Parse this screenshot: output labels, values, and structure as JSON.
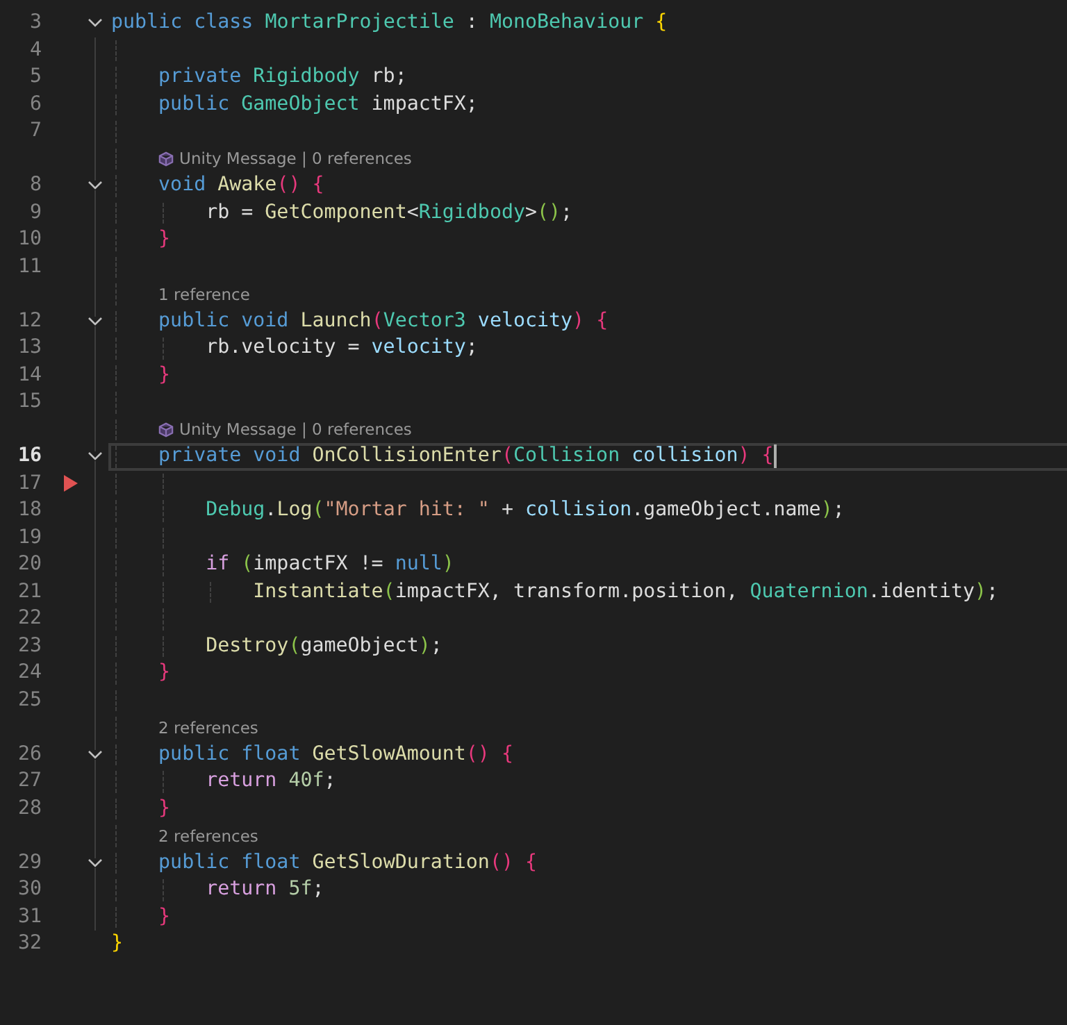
{
  "editor": {
    "rows": [
      {
        "kind": "code",
        "number": "3",
        "foldable": true,
        "selected": false,
        "marker": false,
        "tokens": [
          {
            "text": "public class ",
            "kind": "k"
          },
          {
            "text": "MortarProjectile",
            "kind": "t"
          },
          {
            "text": " : ",
            "kind": "p"
          },
          {
            "text": "MonoBehaviour ",
            "kind": "t"
          },
          {
            "text": "{",
            "kind": "b1"
          }
        ],
        "children": [
          {
            "kind": "code",
            "number": "4",
            "foldable": false,
            "selected": false,
            "marker": false
          },
          {
            "kind": "code",
            "number": "5",
            "foldable": false,
            "selected": false,
            "marker": false,
            "tokens": [
              {
                "text": "private ",
                "kind": "k"
              },
              {
                "text": "Rigidbody",
                "kind": "t"
              },
              {
                "text": " rb;",
                "kind": "p"
              }
            ]
          },
          {
            "kind": "code",
            "number": "6",
            "foldable": false,
            "selected": false,
            "marker": false,
            "tokens": [
              {
                "text": "public ",
                "kind": "k"
              },
              {
                "text": "GameObject",
                "kind": "t"
              },
              {
                "text": " impactFX;",
                "kind": "p"
              }
            ]
          },
          {
            "kind": "code",
            "number": "7",
            "foldable": false,
            "selected": false,
            "marker": false
          },
          {
            "kind": "unity_lens",
            "text": "Unity Message | 0 references"
          },
          {
            "kind": "code",
            "number": "8",
            "foldable": true,
            "selected": false,
            "marker": false,
            "tokens": [
              {
                "text": "void ",
                "kind": "k"
              },
              {
                "text": "Awake",
                "kind": "f"
              },
              {
                "text": "() {",
                "kind": "b2"
              }
            ],
            "children": [
              {
                "kind": "code",
                "number": "9",
                "foldable": false,
                "selected": false,
                "marker": false,
                "tokens": [
                  {
                    "text": "rb = ",
                    "kind": "p"
                  },
                  {
                    "text": "GetComponent",
                    "kind": "f"
                  },
                  {
                    "text": "<",
                    "kind": "p"
                  },
                  {
                    "text": "Rigidbody",
                    "kind": "t"
                  },
                  {
                    "text": ">",
                    "kind": "p"
                  },
                  {
                    "text": "()",
                    "kind": "b3"
                  },
                  {
                    "text": ";",
                    "kind": "p"
                  }
                ]
              }
            ]
          },
          {
            "kind": "code",
            "number": "10",
            "foldable": false,
            "selected": false,
            "marker": false,
            "tokens": [
              {
                "text": "}",
                "kind": "b2"
              }
            ]
          },
          {
            "kind": "code",
            "number": "11",
            "foldable": false,
            "selected": false,
            "marker": false
          },
          {
            "kind": "lens",
            "text": "1 reference"
          },
          {
            "kind": "code",
            "number": "12",
            "foldable": true,
            "selected": false,
            "marker": false,
            "tokens": [
              {
                "text": "public void ",
                "kind": "k"
              },
              {
                "text": "Launch",
                "kind": "f"
              },
              {
                "text": "(",
                "kind": "b2"
              },
              {
                "text": "Vector3",
                "kind": "t"
              },
              {
                "text": " velocity",
                "kind": "v"
              },
              {
                "text": ") {",
                "kind": "b2"
              }
            ],
            "children": [
              {
                "kind": "code",
                "number": "13",
                "foldable": false,
                "selected": false,
                "marker": false,
                "tokens": [
                  {
                    "text": "rb.velocity = ",
                    "kind": "p"
                  },
                  {
                    "text": "velocity",
                    "kind": "v"
                  },
                  {
                    "text": ";",
                    "kind": "p"
                  }
                ]
              }
            ]
          },
          {
            "kind": "code",
            "number": "14",
            "foldable": false,
            "selected": false,
            "marker": false,
            "tokens": [
              {
                "text": "}",
                "kind": "b2"
              }
            ]
          },
          {
            "kind": "code",
            "number": "15",
            "foldable": false,
            "selected": false,
            "marker": false
          },
          {
            "kind": "unity_lens",
            "text": "Unity Message | 0 references"
          },
          {
            "kind": "code",
            "number": "16",
            "foldable": true,
            "selected": true,
            "marker": false,
            "tokens": [
              {
                "text": "private void ",
                "kind": "k"
              },
              {
                "text": "OnCollisionEnter",
                "kind": "f"
              },
              {
                "text": "(",
                "kind": "b2"
              },
              {
                "text": "Collision",
                "kind": "t"
              },
              {
                "text": " collision",
                "kind": "v"
              },
              {
                "text": ") {",
                "kind": "b2"
              }
            ],
            "children": [
              {
                "kind": "code",
                "number": "17",
                "foldable": false,
                "selected": false,
                "marker": true
              },
              {
                "kind": "code",
                "number": "18",
                "foldable": false,
                "selected": false,
                "marker": false,
                "tokens": [
                  {
                    "text": "Debug",
                    "kind": "t"
                  },
                  {
                    "text": ".",
                    "kind": "p"
                  },
                  {
                    "text": "Log",
                    "kind": "f"
                  },
                  {
                    "text": "(",
                    "kind": "b3"
                  },
                  {
                    "text": "\"Mortar hit: \"",
                    "kind": "s"
                  },
                  {
                    "text": " + ",
                    "kind": "p"
                  },
                  {
                    "text": "collision",
                    "kind": "v"
                  },
                  {
                    "text": ".gameObject.name",
                    "kind": "p"
                  },
                  {
                    "text": ")",
                    "kind": "b3"
                  },
                  {
                    "text": ";",
                    "kind": "p"
                  }
                ]
              },
              {
                "kind": "code",
                "number": "19",
                "foldable": false,
                "selected": false,
                "marker": false
              },
              {
                "kind": "code",
                "number": "20",
                "foldable": false,
                "selected": false,
                "marker": false,
                "tokens": [
                  {
                    "text": "if ",
                    "kind": "c"
                  },
                  {
                    "text": "(",
                    "kind": "b3"
                  },
                  {
                    "text": "impactFX != ",
                    "kind": "p"
                  },
                  {
                    "text": "null",
                    "kind": "k"
                  },
                  {
                    "text": ")",
                    "kind": "b3"
                  }
                ],
                "children": [
                  {
                    "kind": "code",
                    "number": "21",
                    "foldable": false,
                    "selected": false,
                    "marker": false,
                    "tokens": [
                      {
                        "text": "Instantiate",
                        "kind": "f"
                      },
                      {
                        "text": "(",
                        "kind": "b3"
                      },
                      {
                        "text": "impactFX, transform.position, ",
                        "kind": "p"
                      },
                      {
                        "text": "Quaternion",
                        "kind": "t"
                      },
                      {
                        "text": ".identity",
                        "kind": "p"
                      },
                      {
                        "text": ")",
                        "kind": "b3"
                      },
                      {
                        "text": ";",
                        "kind": "p"
                      }
                    ]
                  }
                ]
              },
              {
                "kind": "code",
                "number": "22",
                "foldable": false,
                "selected": false,
                "marker": false
              },
              {
                "kind": "code",
                "number": "23",
                "foldable": false,
                "selected": false,
                "marker": false,
                "tokens": [
                  {
                    "text": "Destroy",
                    "kind": "f"
                  },
                  {
                    "text": "(",
                    "kind": "b3"
                  },
                  {
                    "text": "gameObject",
                    "kind": "p"
                  },
                  {
                    "text": ")",
                    "kind": "b3"
                  },
                  {
                    "text": ";",
                    "kind": "p"
                  }
                ]
              }
            ]
          },
          {
            "kind": "code",
            "number": "24",
            "foldable": false,
            "selected": false,
            "marker": false,
            "tokens": [
              {
                "text": "}",
                "kind": "b2"
              }
            ]
          },
          {
            "kind": "code",
            "number": "25",
            "foldable": false,
            "selected": false,
            "marker": false
          },
          {
            "kind": "lens",
            "text": "2 references"
          },
          {
            "kind": "code",
            "number": "26",
            "foldable": true,
            "selected": false,
            "marker": false,
            "tokens": [
              {
                "text": "public float ",
                "kind": "k"
              },
              {
                "text": "GetSlowAmount",
                "kind": "f"
              },
              {
                "text": "() {",
                "kind": "b2"
              }
            ],
            "children": [
              {
                "kind": "code",
                "number": "27",
                "foldable": false,
                "selected": false,
                "marker": false,
                "tokens": [
                  {
                    "text": "return ",
                    "kind": "c"
                  },
                  {
                    "text": "40f",
                    "kind": "n"
                  },
                  {
                    "text": ";",
                    "kind": "p"
                  }
                ]
              }
            ]
          },
          {
            "kind": "code",
            "number": "28",
            "foldable": false,
            "selected": false,
            "marker": false,
            "tokens": [
              {
                "text": "}",
                "kind": "b2"
              }
            ]
          },
          {
            "kind": "lens",
            "text": "2 references"
          },
          {
            "kind": "code",
            "number": "29",
            "foldable": true,
            "selected": false,
            "marker": false,
            "tokens": [
              {
                "text": "public float ",
                "kind": "k"
              },
              {
                "text": "GetSlowDuration",
                "kind": "f"
              },
              {
                "text": "() {",
                "kind": "b2"
              }
            ],
            "children": [
              {
                "kind": "code",
                "number": "30",
                "foldable": false,
                "selected": false,
                "marker": false,
                "tokens": [
                  {
                    "text": "return ",
                    "kind": "c"
                  },
                  {
                    "text": "5f",
                    "kind": "n"
                  },
                  {
                    "text": ";",
                    "kind": "p"
                  }
                ]
              }
            ]
          },
          {
            "kind": "code",
            "number": "31",
            "foldable": false,
            "selected": false,
            "marker": false,
            "tokens": [
              {
                "text": "}",
                "kind": "b2"
              }
            ]
          }
        ]
      },
      {
        "kind": "code",
        "number": "32",
        "foldable": false,
        "selected": false,
        "marker": false,
        "tokens": [
          {
            "text": "}",
            "kind": "b1"
          }
        ]
      }
    ]
  }
}
